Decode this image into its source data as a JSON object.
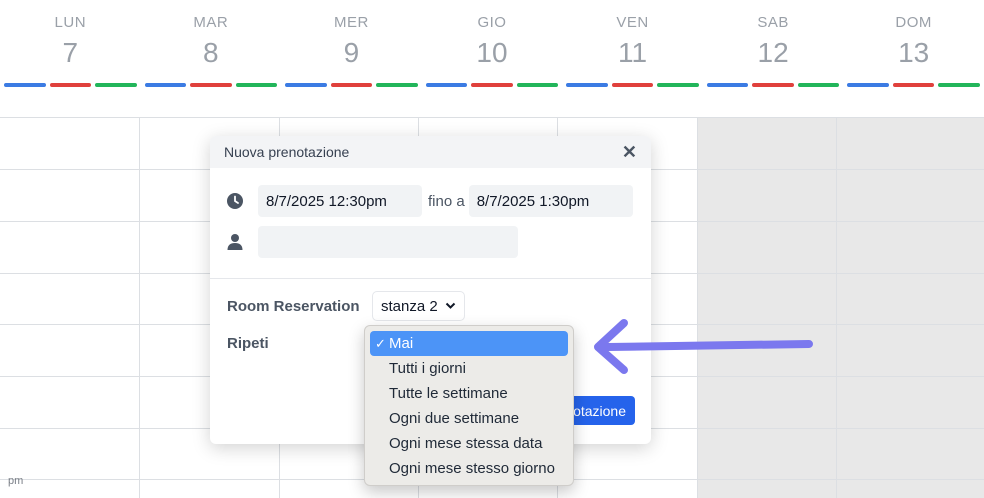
{
  "calendar": {
    "days": [
      {
        "name": "LUN",
        "num": "7"
      },
      {
        "name": "MAR",
        "num": "8"
      },
      {
        "name": "MER",
        "num": "9"
      },
      {
        "name": "GIO",
        "num": "10"
      },
      {
        "name": "VEN",
        "num": "11"
      },
      {
        "name": "SAB",
        "num": "12"
      },
      {
        "name": "DOM",
        "num": "13"
      }
    ],
    "bar_colors": [
      "#3b7be3",
      "#e0403c",
      "#22b55a"
    ],
    "bottom_time_label": "pm"
  },
  "modal": {
    "title": "Nuova prenotazione",
    "close_symbol": "✕",
    "start": "8/7/2025 12:30pm",
    "until_label": "fino a",
    "end": "8/7/2025 1:30pm",
    "user_value": "",
    "room_label": "Room Reservation",
    "room_value": "stanza 2",
    "repeat_label": "Ripeti",
    "submit_label": "otazione"
  },
  "repeat_dropdown": {
    "options": [
      "Mai",
      "Tutti i giorni",
      "Tutte le settimane",
      "Ogni due settimane",
      "Ogni mese stessa data",
      "Ogni mese stesso giorno"
    ],
    "selected": "Mai",
    "check_symbol": "✓"
  },
  "annotation": {
    "arrow_color": "#7b78ee"
  }
}
